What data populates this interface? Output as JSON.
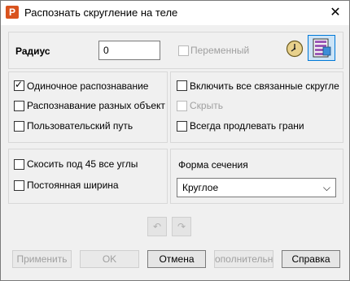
{
  "window": {
    "title": "Распознать скругление на теле"
  },
  "radius": {
    "label": "Радиус",
    "value": "0",
    "variable_label": "Переменный"
  },
  "left_panel": {
    "single_recognition": "Одиночное распознавание",
    "recognize_different_objects": "Распознавание разных объекто",
    "user_path": "Пользовательский путь"
  },
  "right_panel": {
    "include_all_related": "Включить все связанные скругле",
    "hide": "Скрыть",
    "always_extend_faces": "Всегда продлевать грани"
  },
  "bottom_left": {
    "chamfer_45": "Скосить под 45 все углы",
    "constant_width": "Постоянная ширина"
  },
  "section": {
    "label": "Форма сечения",
    "selected": "Круглое"
  },
  "buttons": {
    "apply": "Применить",
    "ok": "OK",
    "cancel": "Отмена",
    "additional": "ополнительн",
    "help": "Справка"
  }
}
